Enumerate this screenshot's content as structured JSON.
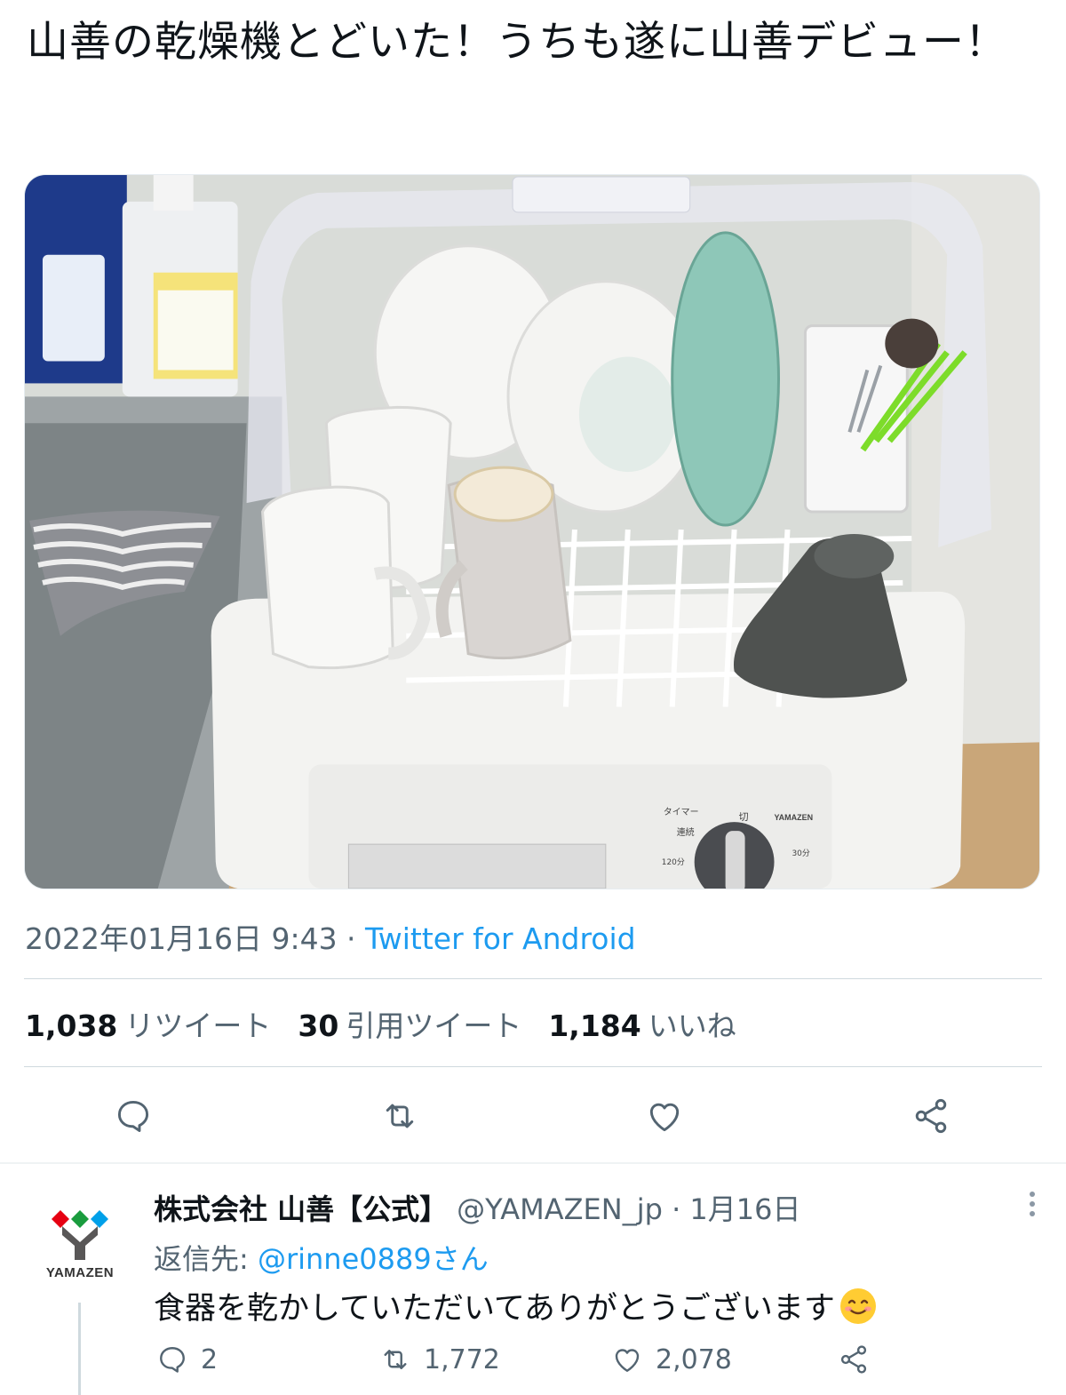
{
  "tweet": {
    "text": "山善の乾燥機とどいた！うちも遂に山善デビュー！",
    "timestamp": "2022年01月16日 9:43",
    "separator": " · ",
    "source": "Twitter for Android",
    "image_alt": "dish-dryer-photo"
  },
  "stats": {
    "retweets": "1,038",
    "retweets_label": "リツイート",
    "quotes": "30",
    "quotes_label": "引用ツイート",
    "likes": "1,184",
    "likes_label": "いいね"
  },
  "photo_labels": {
    "brand": "YAMAZEN",
    "timer": "タイマー",
    "off": "切",
    "continuous": "連続",
    "m30": "30分",
    "m120": "120分"
  },
  "reply": {
    "avatar_text": "YAMAZEN",
    "name": "株式会社 山善【公式】",
    "handle": "@YAMAZEN_jp · 1月16日",
    "reply_to_prefix": "返信先: ",
    "reply_to_mention": "@rinne0889さん",
    "body": "食器を乾かしていただいてありがとうございます",
    "replies": "2",
    "retweets": "1,772",
    "likes": "2,078"
  },
  "icons": {
    "reply": "reply-icon",
    "retweet": "retweet-icon",
    "like": "heart-icon",
    "share": "share-icon",
    "more": "more-icon",
    "emoji": "smiling-face-emoji"
  },
  "colors": {
    "link": "#1d9bf0",
    "muted": "#536471",
    "text": "#0f1419"
  }
}
